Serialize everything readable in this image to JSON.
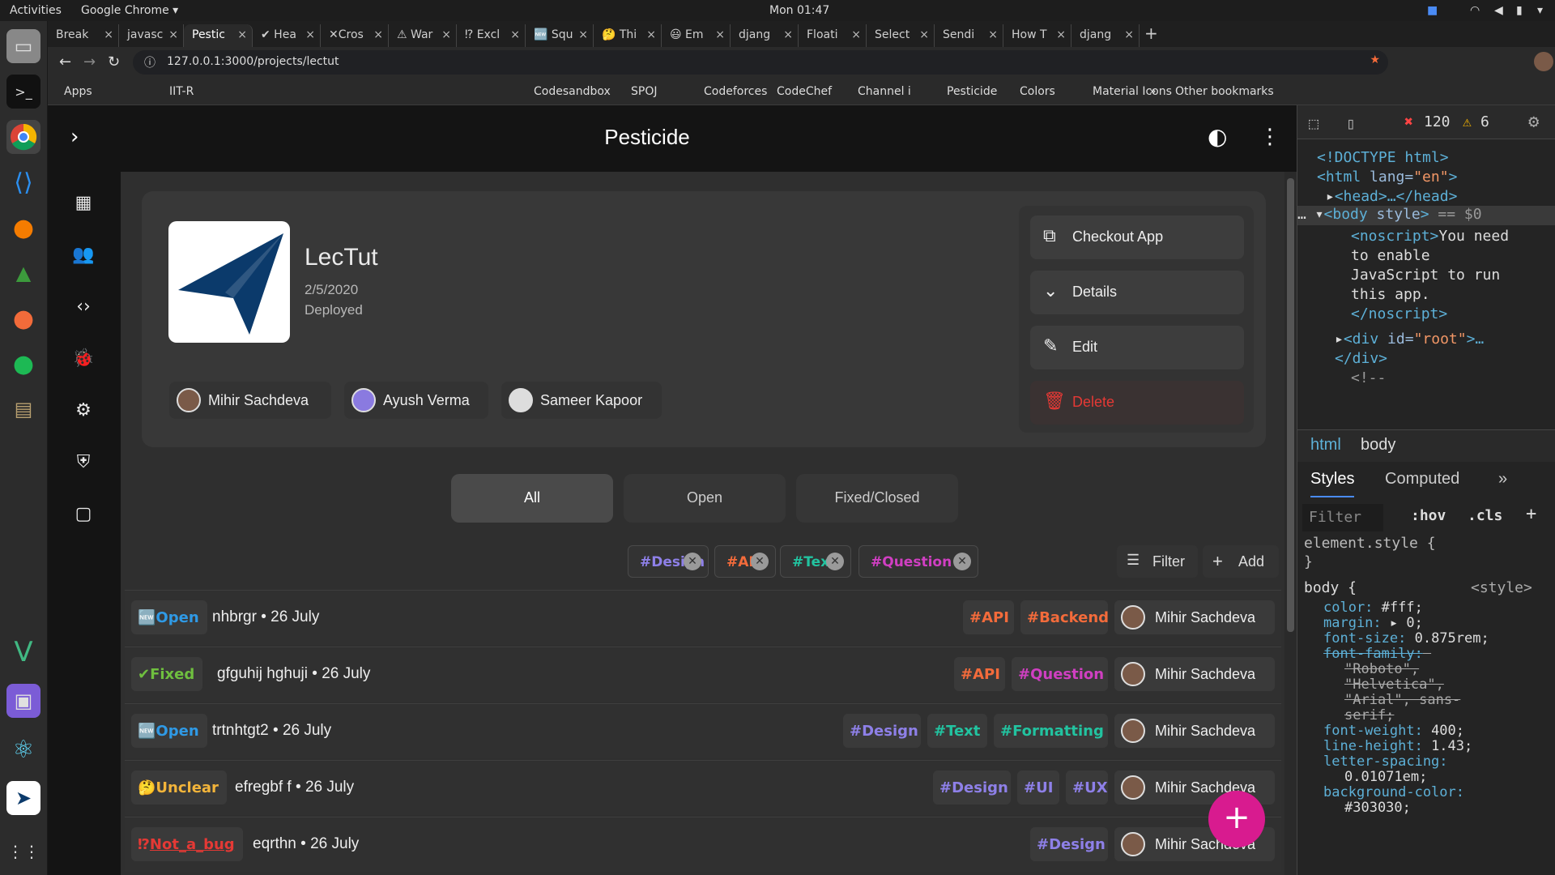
{
  "system": {
    "activities": "Activities",
    "app_menu": "Google Chrome ▾",
    "clock": "Mon 01:47"
  },
  "browser": {
    "tabs": [
      "Break",
      "javasc",
      "Pestic",
      "✔ Hea",
      "✕Cros",
      "⚠ War",
      "⁉ Excl",
      "🆕 Squ",
      "🤔 Thi",
      "😃 Em",
      "djang",
      "Floati",
      "Select",
      "Sendi",
      "How T",
      "djang"
    ],
    "url": "127.0.0.1:3000/projects/lectut",
    "bookmarks": [
      "Apps",
      "IIT-R",
      "Codesandbox",
      "SPOJ",
      "Codeforces",
      "CodeChef",
      "Channel i",
      "Pesticide",
      "Colors",
      "Material Icons",
      "»",
      "Other bookmarks"
    ]
  },
  "app": {
    "title": "Pesticide",
    "project": {
      "name": "LecTut",
      "date": "2/5/2020",
      "status": "Deployed"
    },
    "members": [
      "Mihir Sachdeva",
      "Ayush Verma",
      "Sameer Kapoor"
    ],
    "actions": [
      "Checkout App",
      "Details",
      "Edit",
      "Delete"
    ],
    "filters": [
      "All",
      "Open",
      "Fixed/Closed"
    ],
    "chips": [
      {
        "label": "#Design",
        "color": "#8e80e8"
      },
      {
        "label": "#API",
        "color": "#f36b3b"
      },
      {
        "label": "#Text",
        "color": "#22c3a0"
      },
      {
        "label": "#Question",
        "color": "#d03fc2"
      }
    ],
    "filter_label": "Filter",
    "add_label": "Add",
    "issues": [
      {
        "status": "Open",
        "status_icon": "🆕",
        "status_color": "#2f9ae6",
        "title": "nhbrgr",
        "date": "26 July",
        "tags": [
          {
            "label": "#API",
            "color": "#f36b3b"
          },
          {
            "label": "#Backend",
            "color": "#f36b3b"
          }
        ],
        "assignee": "Mihir Sachdeva"
      },
      {
        "status": "Fixed",
        "status_icon": "✔",
        "status_color": "#6fbf3f",
        "title": "gfguhij hghuji",
        "date": "26 July",
        "tags": [
          {
            "label": "#API",
            "color": "#f36b3b"
          },
          {
            "label": "#Question",
            "color": "#d03fc2"
          }
        ],
        "assignee": "Mihir Sachdeva"
      },
      {
        "status": "Open",
        "status_icon": "🆕",
        "status_color": "#2f9ae6",
        "title": "trtnhtgt2",
        "date": "26 July",
        "tags": [
          {
            "label": "#Design",
            "color": "#8e80e8"
          },
          {
            "label": "#Text",
            "color": "#22c3a0"
          },
          {
            "label": "#Formatting",
            "color": "#22c3a0"
          }
        ],
        "assignee": "Mihir Sachdeva"
      },
      {
        "status": "Unclear",
        "status_icon": "🤔",
        "status_color": "#f2b43a",
        "title": "efregbf f",
        "date": "26 July",
        "tags": [
          {
            "label": "#Design",
            "color": "#8e80e8"
          },
          {
            "label": "#UI",
            "color": "#8e80e8"
          },
          {
            "label": "#UX",
            "color": "#8e80e8"
          }
        ],
        "assignee": "Mihir Sachdeva"
      },
      {
        "status": "Not_a_bug",
        "status_icon": "⁉",
        "status_color": "#e53935",
        "title": "eqrthn",
        "date": "26 July",
        "tags": [
          {
            "label": "#Design",
            "color": "#8e80e8"
          }
        ],
        "assignee": "Mihir Sachdeva"
      }
    ]
  },
  "devtools": {
    "errors": "120",
    "warnings": "6",
    "crumbs": [
      "html",
      "body"
    ],
    "tabs": [
      "Styles",
      "Computed",
      "»"
    ],
    "filter_placeholder": "Filter",
    "hov": ":hov",
    "cls": ".cls",
    "element_style": "element.style {",
    "close_brace": "}",
    "body_selector": "body {",
    "style_source": "<style>",
    "props": [
      [
        "color:",
        "#fff;"
      ],
      [
        "margin:",
        "▸ 0;"
      ],
      [
        "font-size:",
        "0.875rem;"
      ],
      [
        "font-family:",
        ""
      ],
      [
        "",
        "\"Roboto\","
      ],
      [
        "",
        "\"Helvetica\","
      ],
      [
        "",
        "\"Arial\", sans-"
      ],
      [
        "",
        "serif;"
      ],
      [
        "font-weight:",
        "400;"
      ],
      [
        "line-height:",
        "1.43;"
      ],
      [
        "letter-spacing:",
        ""
      ],
      [
        "",
        "0.01071em;"
      ],
      [
        "background-color:",
        ""
      ],
      [
        "",
        "#303030;"
      ]
    ]
  }
}
